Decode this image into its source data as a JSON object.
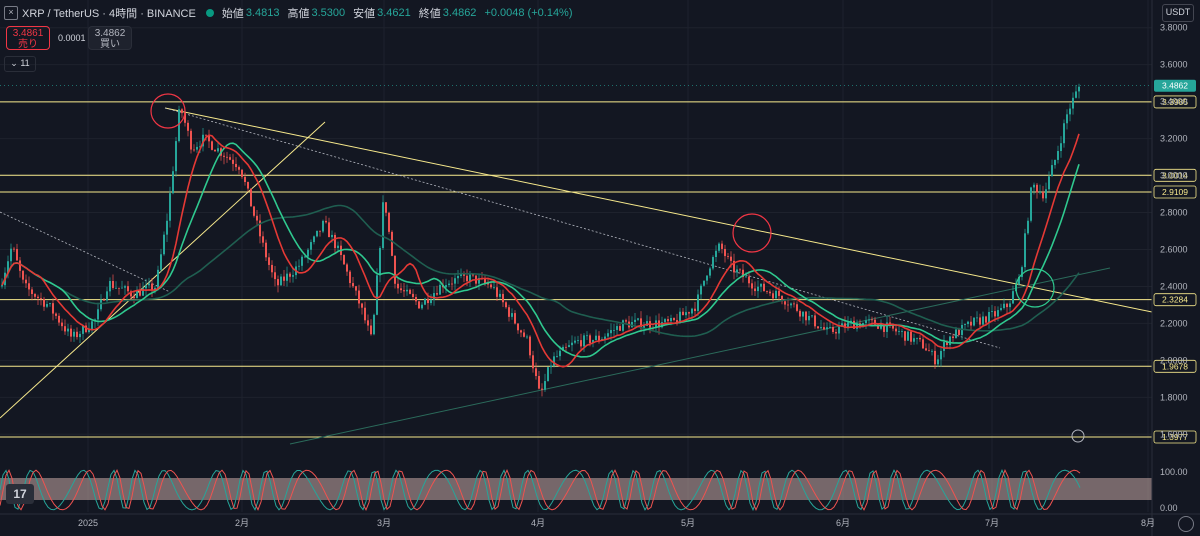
{
  "header": {
    "symbol": "XRP / TetherUS · 4時間 · BINANCE",
    "open_label": "始値",
    "open": "3.4813",
    "high_label": "高値",
    "high": "3.5300",
    "low_label": "安値",
    "low": "3.4621",
    "close_label": "終値",
    "close": "3.4862",
    "change": "+0.0048 (+0.14%)"
  },
  "trade": {
    "sell_price": "3.4861",
    "sell_label": "売り",
    "spread": "0.0001",
    "buy_price": "3.4862",
    "buy_label": "買い"
  },
  "indicator_toggle": "11",
  "currency": "USDT",
  "logo": "17",
  "colors": {
    "bg": "#131722",
    "up": "#26a69a",
    "down": "#ef5350",
    "hline": "#f7e98c",
    "ma_red": "#e53935",
    "ma_green": "#2fc98f",
    "ma_dark": "#1f5e50",
    "circle": "#f23645"
  },
  "chart_data": {
    "type": "candlestick",
    "x_ticks": [
      "2025",
      "2月",
      "3月",
      "4月",
      "5月",
      "6月",
      "7月",
      "8月"
    ],
    "y_ticks": [
      "3.8000",
      "3.6000",
      "3.4000",
      "3.2000",
      "3.0000",
      "2.8000",
      "2.6000",
      "2.4000",
      "2.2000",
      "2.0000",
      "1.8000",
      "1.6000"
    ],
    "ylim": [
      1.45,
      3.95
    ],
    "current_price": "3.4862",
    "horizontal_levels": [
      {
        "value": 3.3985,
        "label": "3.3985"
      },
      {
        "value": 3.0014,
        "label": "3.0014"
      },
      {
        "value": 2.9109,
        "label": "2.9109"
      },
      {
        "value": 2.3284,
        "label": "2.3284"
      },
      {
        "value": 1.9678,
        "label": "1.9678"
      },
      {
        "value": 1.3977,
        "label": "1.3977"
      }
    ],
    "oscillator_ticks": [
      "100.00",
      "0.00"
    ],
    "price_path": [
      {
        "t": 0.0,
        "p": 2.4
      },
      {
        "t": 0.01,
        "p": 2.62
      },
      {
        "t": 0.02,
        "p": 2.4
      },
      {
        "t": 0.04,
        "p": 2.3
      },
      {
        "t": 0.06,
        "p": 2.12
      },
      {
        "t": 0.08,
        "p": 2.22
      },
      {
        "t": 0.09,
        "p": 2.42
      },
      {
        "t": 0.11,
        "p": 2.36
      },
      {
        "t": 0.13,
        "p": 2.4
      },
      {
        "t": 0.14,
        "p": 2.8
      },
      {
        "t": 0.15,
        "p": 3.38
      },
      {
        "t": 0.16,
        "p": 3.15
      },
      {
        "t": 0.17,
        "p": 3.2
      },
      {
        "t": 0.19,
        "p": 3.1
      },
      {
        "t": 0.2,
        "p": 3.05
      },
      {
        "t": 0.22,
        "p": 2.6
      },
      {
        "t": 0.23,
        "p": 2.4
      },
      {
        "t": 0.25,
        "p": 2.52
      },
      {
        "t": 0.27,
        "p": 2.74
      },
      {
        "t": 0.28,
        "p": 2.62
      },
      {
        "t": 0.3,
        "p": 2.3
      },
      {
        "t": 0.31,
        "p": 2.1
      },
      {
        "t": 0.32,
        "p": 2.9
      },
      {
        "t": 0.33,
        "p": 2.4
      },
      {
        "t": 0.35,
        "p": 2.3
      },
      {
        "t": 0.37,
        "p": 2.42
      },
      {
        "t": 0.39,
        "p": 2.45
      },
      {
        "t": 0.41,
        "p": 2.4
      },
      {
        "t": 0.43,
        "p": 2.2
      },
      {
        "t": 0.44,
        "p": 2.1
      },
      {
        "t": 0.45,
        "p": 1.8
      },
      {
        "t": 0.46,
        "p": 2.0
      },
      {
        "t": 0.48,
        "p": 2.1
      },
      {
        "t": 0.5,
        "p": 2.12
      },
      {
        "t": 0.52,
        "p": 2.2
      },
      {
        "t": 0.54,
        "p": 2.2
      },
      {
        "t": 0.56,
        "p": 2.2
      },
      {
        "t": 0.58,
        "p": 2.3
      },
      {
        "t": 0.59,
        "p": 2.5
      },
      {
        "t": 0.6,
        "p": 2.62
      },
      {
        "t": 0.61,
        "p": 2.5
      },
      {
        "t": 0.63,
        "p": 2.4
      },
      {
        "t": 0.65,
        "p": 2.35
      },
      {
        "t": 0.67,
        "p": 2.25
      },
      {
        "t": 0.69,
        "p": 2.15
      },
      {
        "t": 0.71,
        "p": 2.2
      },
      {
        "t": 0.73,
        "p": 2.2
      },
      {
        "t": 0.75,
        "p": 2.15
      },
      {
        "t": 0.77,
        "p": 2.08
      },
      {
        "t": 0.78,
        "p": 2.0
      },
      {
        "t": 0.79,
        "p": 2.12
      },
      {
        "t": 0.81,
        "p": 2.2
      },
      {
        "t": 0.83,
        "p": 2.25
      },
      {
        "t": 0.84,
        "p": 2.3
      },
      {
        "t": 0.85,
        "p": 2.45
      },
      {
        "t": 0.86,
        "p": 2.95
      },
      {
        "t": 0.87,
        "p": 2.9
      },
      {
        "t": 0.88,
        "p": 3.1
      },
      {
        "t": 0.89,
        "p": 3.35
      },
      {
        "t": 0.9,
        "p": 3.49
      }
    ]
  }
}
